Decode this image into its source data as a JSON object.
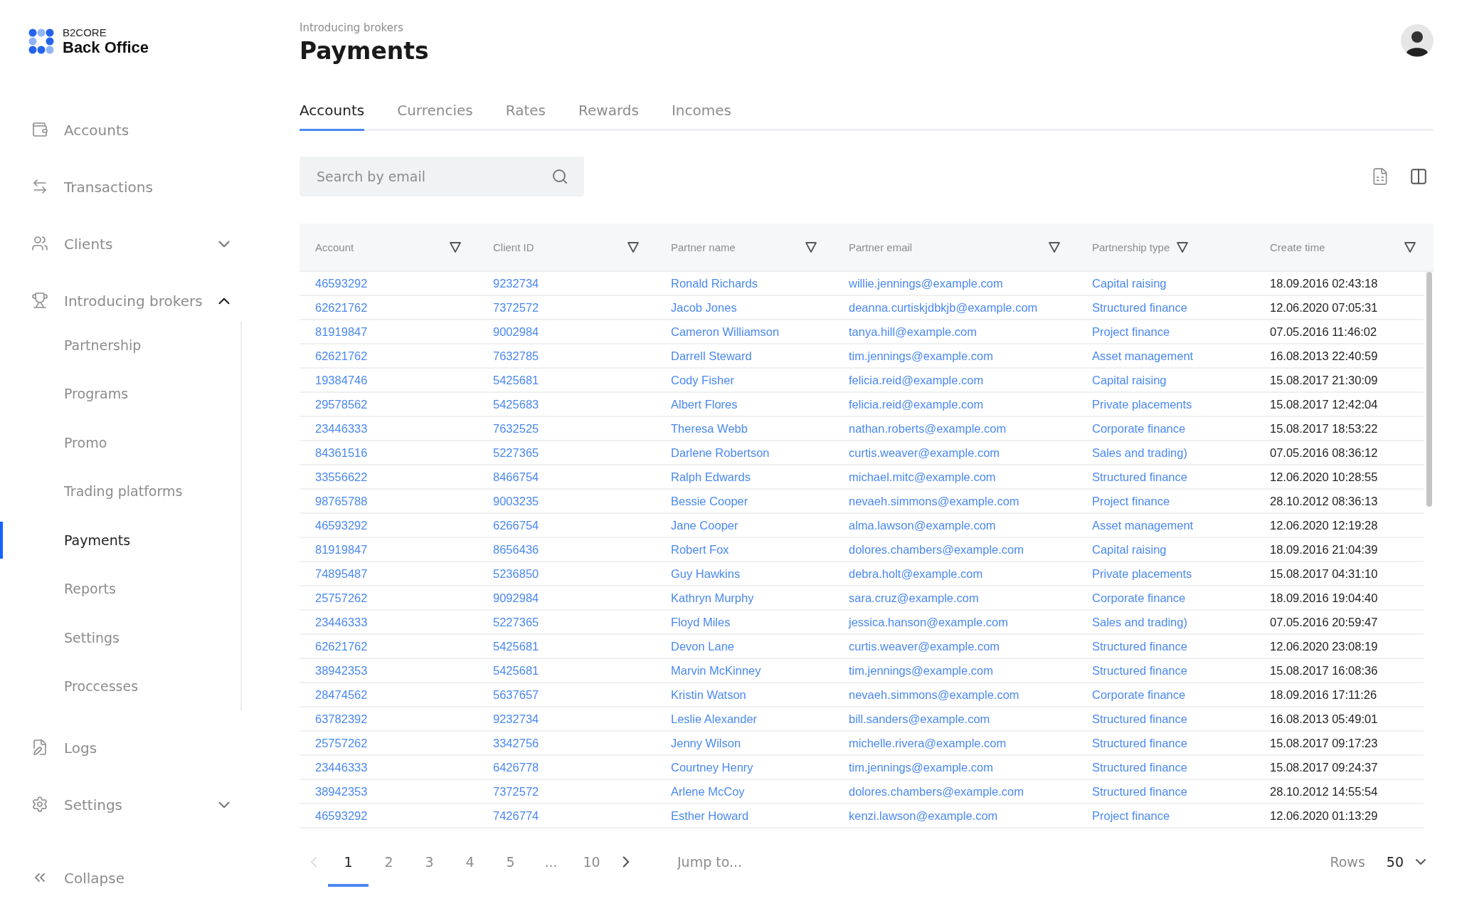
{
  "logo": {
    "overline": "B2CORE",
    "name": "Back Office"
  },
  "sidebar": {
    "items": [
      {
        "kind": "link",
        "label": "Accounts",
        "selected": false
      },
      {
        "kind": "link",
        "label": "Transactions",
        "selected": false
      },
      {
        "kind": "group",
        "label": "Clients",
        "selected": false,
        "expanded": false
      },
      {
        "kind": "group",
        "label": "Introducing brokers",
        "selected": false,
        "expanded": true,
        "children": [
          {
            "label": "Partnership",
            "selected": false
          },
          {
            "label": "Programs",
            "selected": false
          },
          {
            "label": "Promo",
            "selected": false
          },
          {
            "label": "Trading platforms",
            "selected": false
          },
          {
            "label": "Payments",
            "selected": true
          },
          {
            "label": "Reports",
            "selected": false
          },
          {
            "label": "Settings",
            "selected": false
          },
          {
            "label": "Proccesses",
            "selected": false
          }
        ]
      },
      {
        "kind": "link",
        "label": "Logs",
        "selected": false
      },
      {
        "kind": "group",
        "label": "Settings",
        "selected": false,
        "expanded": false
      }
    ],
    "collapse": "Collapse"
  },
  "header": {
    "breadcrumb": "Introducing brokers",
    "title": "Payments"
  },
  "tabs": [
    {
      "label": "Accounts",
      "selected": true
    },
    {
      "label": "Currencies",
      "selected": false
    },
    {
      "label": "Rates",
      "selected": false
    },
    {
      "label": "Rewards",
      "selected": false
    },
    {
      "label": "Incomes",
      "selected": false
    }
  ],
  "search": {
    "placeholder": "Search by email"
  },
  "table": {
    "columns": [
      "Account",
      "Client ID",
      "Partner name",
      "Partner email",
      "Partnership type",
      "Create time"
    ],
    "rows": [
      [
        "46593292",
        "9232734",
        "Ronald Richards",
        "willie.jennings@example.com",
        "Capital raising",
        "18.09.2016 02:43:18"
      ],
      [
        "62621762",
        "7372572",
        "Jacob Jones",
        "deanna.curtiskjdbkjb@example.com",
        "Structured finance",
        "12.06.2020 07:05:31"
      ],
      [
        "81919847",
        "9002984",
        "Cameron Williamson",
        "tanya.hill@example.com",
        "Project finance",
        "07.05.2016 11:46:02"
      ],
      [
        "62621762",
        "7632785",
        "Darrell Steward",
        "tim.jennings@example.com",
        "Asset management",
        "16.08.2013 22:40:59"
      ],
      [
        "19384746",
        "5425681",
        "Cody Fisher",
        "felicia.reid@example.com",
        "Capital raising",
        "15.08.2017 21:30:09"
      ],
      [
        "29578562",
        "5425683",
        "Albert Flores",
        "felicia.reid@example.com",
        "Private placements",
        "15.08.2017 12:42:04"
      ],
      [
        "23446333",
        "7632525",
        "Theresa Webb",
        "nathan.roberts@example.com",
        "Corporate finance",
        "15.08.2017 18:53:22"
      ],
      [
        "84361516",
        "5227365",
        "Darlene Robertson",
        "curtis.weaver@example.com",
        "Sales and trading)",
        "07.05.2016 08:36:12"
      ],
      [
        "33556622",
        "8466754",
        "Ralph Edwards",
        "michael.mitc@example.com",
        "Structured finance",
        "12.06.2020 10:28:55"
      ],
      [
        "98765788",
        "9003235",
        "Bessie Cooper",
        "nevaeh.simmons@example.com",
        "Project finance",
        "28.10.2012 08:36:13"
      ],
      [
        "46593292",
        "6266754",
        "Jane Cooper",
        "alma.lawson@example.com",
        "Asset management",
        "12.06.2020 12:19:28"
      ],
      [
        "81919847",
        "8656436",
        "Robert Fox",
        "dolores.chambers@example.com",
        "Capital raising",
        "18.09.2016 21:04:39"
      ],
      [
        "74895487",
        "5236850",
        "Guy Hawkins",
        "debra.holt@example.com",
        "Private placements",
        "15.08.2017 04:31:10"
      ],
      [
        "25757262",
        "9092984",
        "Kathryn Murphy",
        "sara.cruz@example.com",
        "Corporate finance",
        "18.09.2016 19:04:40"
      ],
      [
        "23446333",
        "5227365",
        "Floyd Miles",
        "jessica.hanson@example.com",
        "Sales and trading)",
        "07.05.2016 20:59:47"
      ],
      [
        "62621762",
        "5425681",
        "Devon Lane",
        "curtis.weaver@example.com",
        "Structured finance",
        "12.06.2020 23:08:19"
      ],
      [
        "38942353",
        "5425681",
        "Marvin McKinney",
        "tim.jennings@example.com",
        "Structured finance",
        "15.08.2017 16:08:36"
      ],
      [
        "28474562",
        "5637657",
        "Kristin Watson",
        "nevaeh.simmons@example.com",
        "Corporate finance",
        "18.09.2016 17:11:26"
      ],
      [
        "63782392",
        "9232734",
        "Leslie Alexander",
        "bill.sanders@example.com",
        "Structured finance",
        "16.08.2013 05:49:01"
      ],
      [
        "25757262",
        "3342756",
        "Jenny Wilson",
        "michelle.rivera@example.com",
        "Structured finance",
        "15.08.2017 09:17:23"
      ],
      [
        "23446333",
        "6426778",
        "Courtney Henry",
        "tim.jennings@example.com",
        "Structured finance",
        "15.08.2017 09:24:37"
      ],
      [
        "38942353",
        "7372572",
        "Arlene McCoy",
        "dolores.chambers@example.com",
        "Structured finance",
        "28.10.2012 14:55:54"
      ],
      [
        "46593292",
        "7426774",
        "Esther Howard",
        "kenzi.lawson@example.com",
        "Project finance",
        "12.06.2020 01:13:29"
      ]
    ]
  },
  "pagination": {
    "prev_disabled": true,
    "pages": [
      {
        "label": "1",
        "selected": true
      },
      {
        "label": "2",
        "selected": false
      },
      {
        "label": "3",
        "selected": false
      },
      {
        "label": "4",
        "selected": false
      },
      {
        "label": "5",
        "selected": false
      },
      {
        "label": "...",
        "selected": false
      },
      {
        "label": "10",
        "selected": false
      }
    ],
    "jump_placeholder": "Jump to...",
    "rows_label": "Rows",
    "rows_value": "50"
  }
}
